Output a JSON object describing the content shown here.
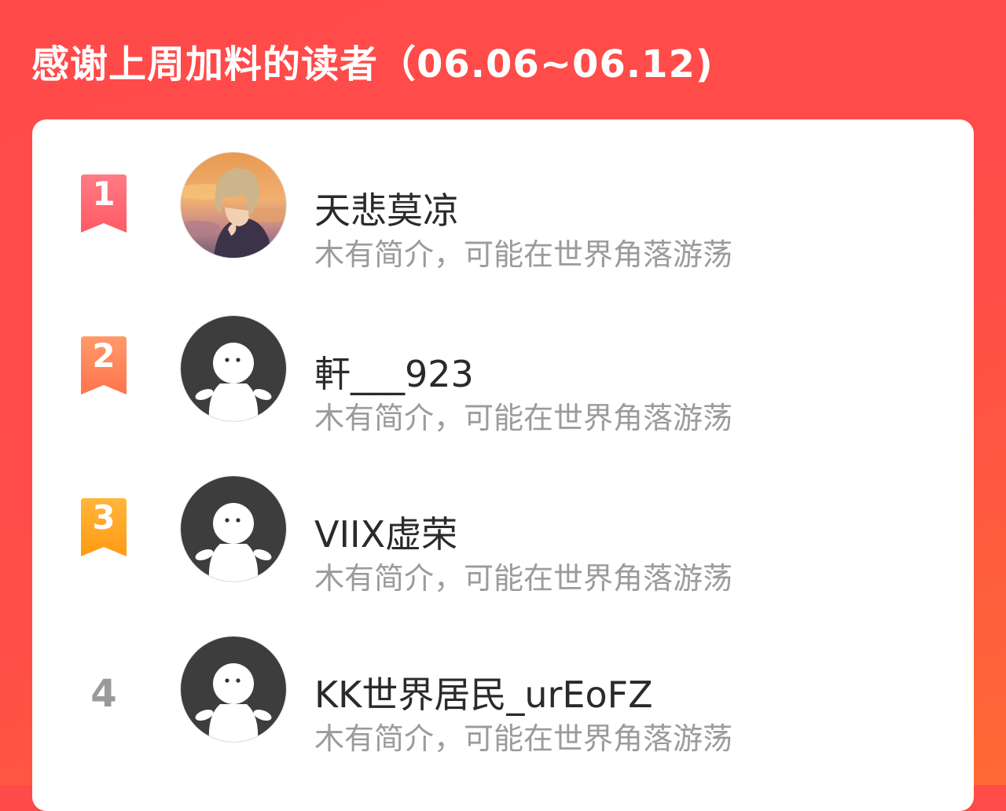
{
  "header": {
    "title": "感谢上周加料的读者（06.06~06.12)"
  },
  "colors": {
    "background": "#ff4a4a",
    "rank1": "#ff5c68",
    "rank2": "#ff7a52",
    "rank3": "#ffa21e",
    "rank_plain": "#9a9a9a",
    "name": "#2a2a2a",
    "bio": "#9b9b9b"
  },
  "readers": [
    {
      "rank": "1",
      "name": "天悲莫凉",
      "bio": "木有简介，可能在世界角落游荡",
      "avatar": "anime-avatar-icon"
    },
    {
      "rank": "2",
      "name": "軒___923",
      "bio": "木有简介，可能在世界角落游荡",
      "avatar": "default-avatar-icon"
    },
    {
      "rank": "3",
      "name": "VIIX虚荣",
      "bio": "木有简介，可能在世界角落游荡",
      "avatar": "default-avatar-icon"
    },
    {
      "rank": "4",
      "name": "KK世界居民_urEoFZ",
      "bio": "木有简介，可能在世界角落游荡",
      "avatar": "default-avatar-icon"
    }
  ]
}
